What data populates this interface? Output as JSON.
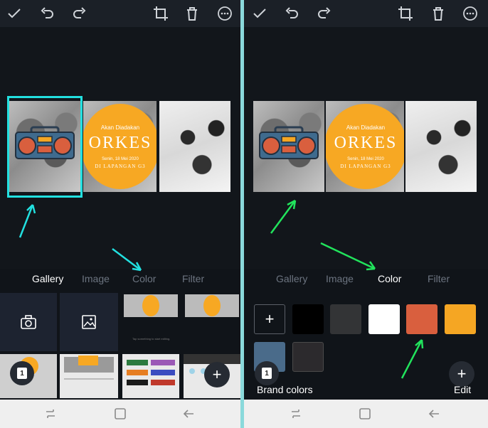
{
  "colors": {
    "accent_cyan": "#22e0e0",
    "accent_green": "#21e35c",
    "orange": "#f7a823"
  },
  "toolbar_icons": [
    "check-icon",
    "undo-icon",
    "redo-icon",
    "crop-icon",
    "trash-icon",
    "more-icon"
  ],
  "design": {
    "small_text": "Akan Diadakan",
    "title": "ORKES",
    "date": "Senin, 18 Mei 2020",
    "location": "DI LAPANGAN G3"
  },
  "tabs": [
    "Gallery",
    "Image",
    "Color",
    "Filter"
  ],
  "left": {
    "active_tab": "Gallery",
    "page_count": "1",
    "thumb_caption": "Tap something to start editing."
  },
  "right": {
    "active_tab": "Color",
    "page_count": "1",
    "swatches": [
      "#000000",
      "#333436",
      "#ffffff",
      "#d95f3e",
      "#f5a623",
      "#4a6b8a",
      "#2c2a2d"
    ],
    "brand_colors_label": "Brand colors",
    "edit_label": "Edit",
    "add_symbol": "+"
  },
  "nav_icons": [
    "recent-apps-icon",
    "home-icon",
    "back-icon"
  ]
}
